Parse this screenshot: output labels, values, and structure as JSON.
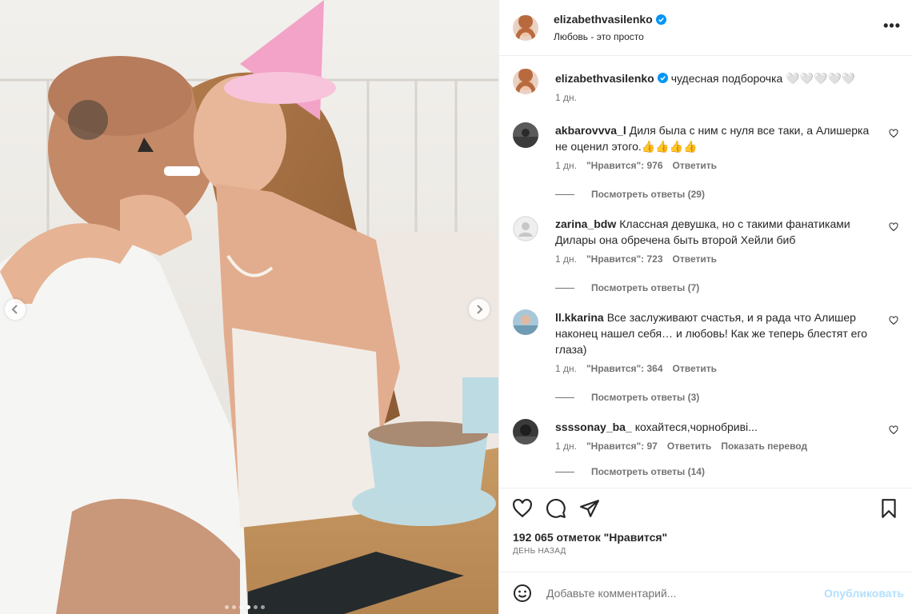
{
  "post": {
    "author": "elizabethvasilenko",
    "subtitle": "Любовь - это просто",
    "more_icon": "more-horizontal-icon"
  },
  "media": {
    "description_alt": "photo",
    "carousel": {
      "count": 6,
      "active_index": 3
    },
    "prev_icon": "chevron-left-icon",
    "next_icon": "chevron-right-icon"
  },
  "caption": {
    "username": "elizabethvasilenko",
    "text": "чудесная подборочка 🤍🤍🤍🤍🤍",
    "time": "1 дн."
  },
  "comments": [
    {
      "username": "akbarovvva_l",
      "text": "Диля была с ним с нуля все таки, а Алишерка не оценил этого.👍👍👍👍",
      "time": "1 дн.",
      "likes": "\"Нравится\": 976",
      "reply": "Ответить",
      "view_replies": "Посмотреть ответы (29)"
    },
    {
      "username": "zarina_bdw",
      "text": "Классная девушка, но с такими фанатиками Дилары она обречена быть второй Хейли биб",
      "time": "1 дн.",
      "likes": "\"Нравится\": 723",
      "reply": "Ответить",
      "view_replies": "Посмотреть ответы (7)"
    },
    {
      "username": "ll.kkarina",
      "text": "Все заслуживают счастья, и я рада что Алишер наконец нашел себя… и любовь! Как же теперь блестят его глаза)",
      "time": "1 дн.",
      "likes": "\"Нравится\": 364",
      "reply": "Ответить",
      "view_replies": "Посмотреть ответы (3)"
    },
    {
      "username": "ssssonay_ba_",
      "text": "кохайтеся,чорнобриві...",
      "time": "1 дн.",
      "likes": "\"Нравится\": 97",
      "reply": "Ответить",
      "translate": "Показать перевод",
      "view_replies": "Посмотреть ответы (14)"
    }
  ],
  "actions": {
    "like_icon": "heart-icon",
    "comment_icon": "comment-icon",
    "share_icon": "send-icon",
    "save_icon": "bookmark-icon"
  },
  "likes_text": "192 065 отметок \"Нравится\"",
  "date_text": "ДЕНЬ НАЗАД",
  "composer": {
    "placeholder": "Добавьте комментарий...",
    "publish": "Опубликовать",
    "emoji_icon": "emoji-icon"
  },
  "colors": {
    "verified": "#0095f6",
    "text": "#262626",
    "secondary": "#737373",
    "publish_disabled": "#b2dffc"
  }
}
